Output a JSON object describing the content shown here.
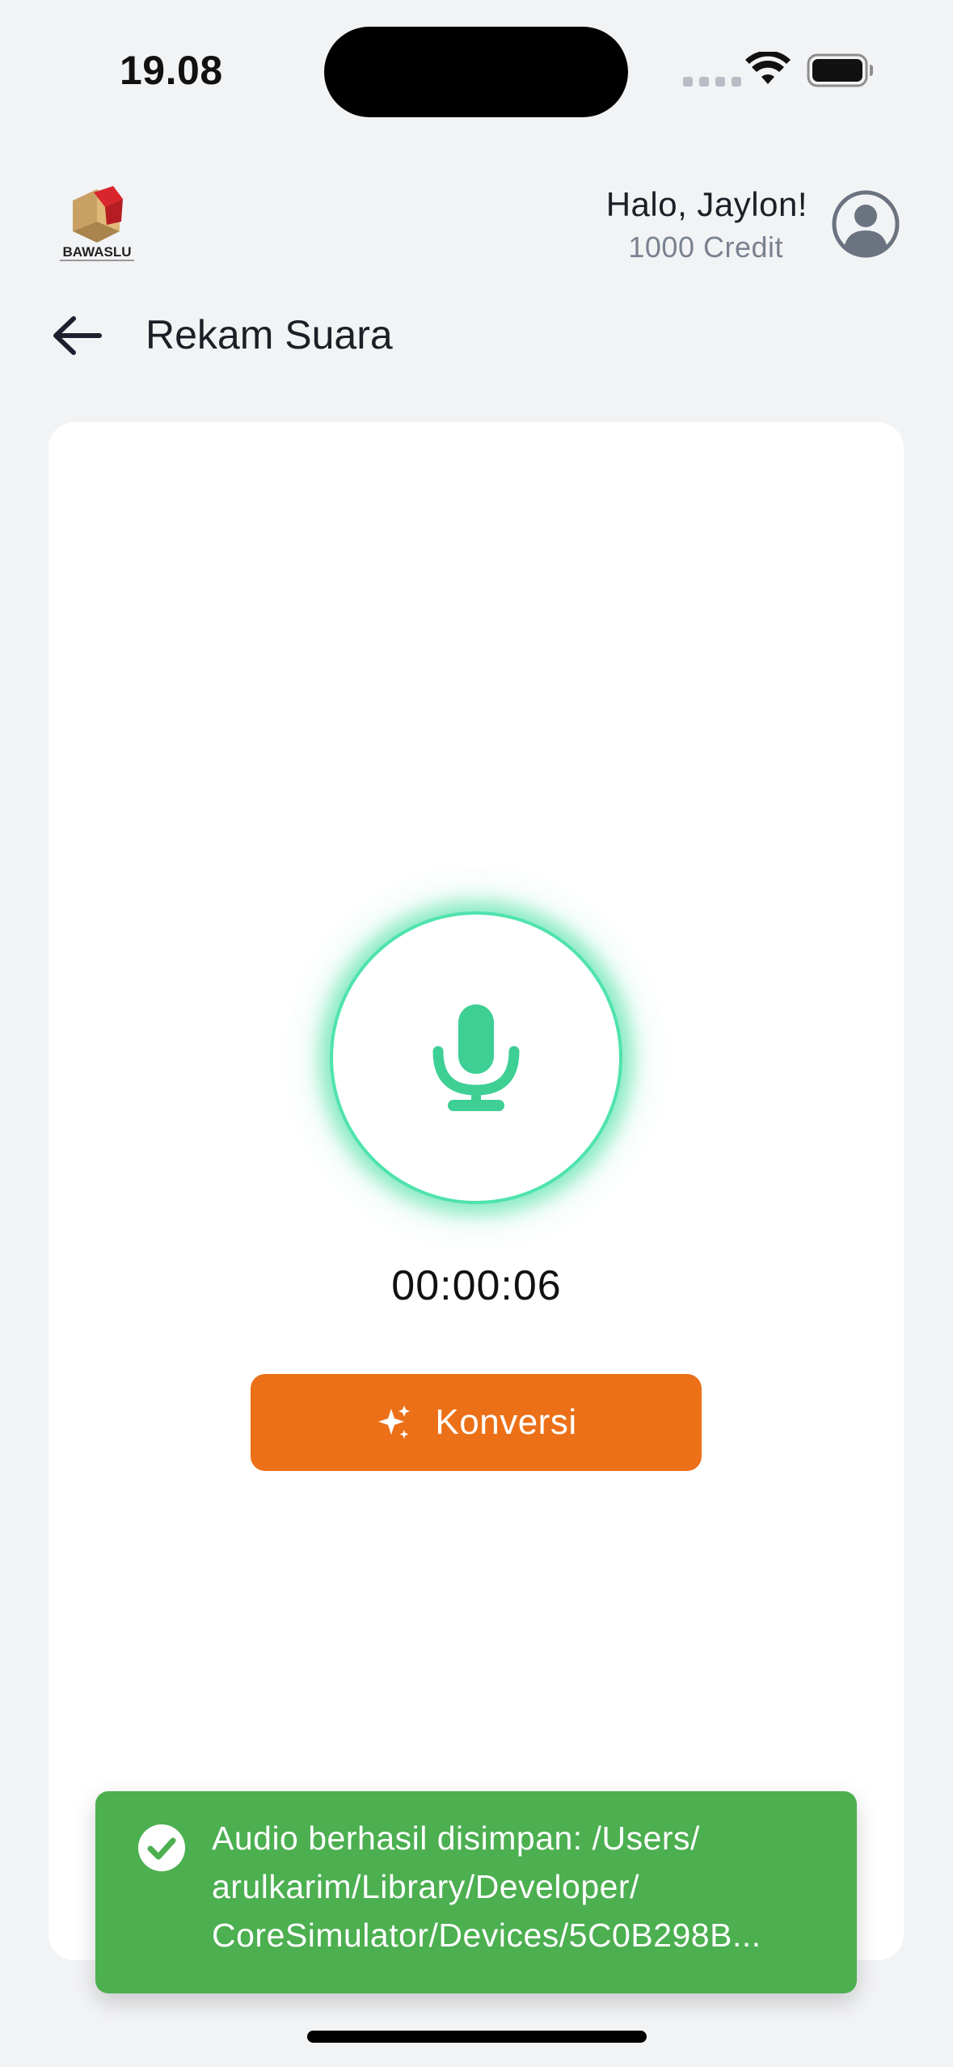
{
  "status_bar": {
    "time": "19.08",
    "icons": [
      "signal-dots-icon",
      "wifi-icon",
      "battery-icon"
    ]
  },
  "header": {
    "logo_text": "BAWASLU",
    "greeting": "Halo, Jaylon!",
    "credit": "1000 Credit",
    "avatar_icon": "user-circle-icon"
  },
  "title_bar": {
    "back_icon": "arrow-left-icon",
    "title": "Rekam Suara"
  },
  "recorder": {
    "mic_icon": "microphone-icon",
    "timer": "00:00:06",
    "convert_label": "Konversi",
    "convert_icon": "sparkle-icon"
  },
  "toast": {
    "icon": "check-circle-icon",
    "message": "Audio berhasil disimpan: /Users/\narulkarim/Library/Developer/\nCoreSimulator/Devices/5C0B298B..."
  },
  "colors": {
    "background": "#f2f3f5",
    "accent_green": "#3ecf95",
    "button_orange": "#ec7018",
    "toast_green": "#4caf50"
  }
}
